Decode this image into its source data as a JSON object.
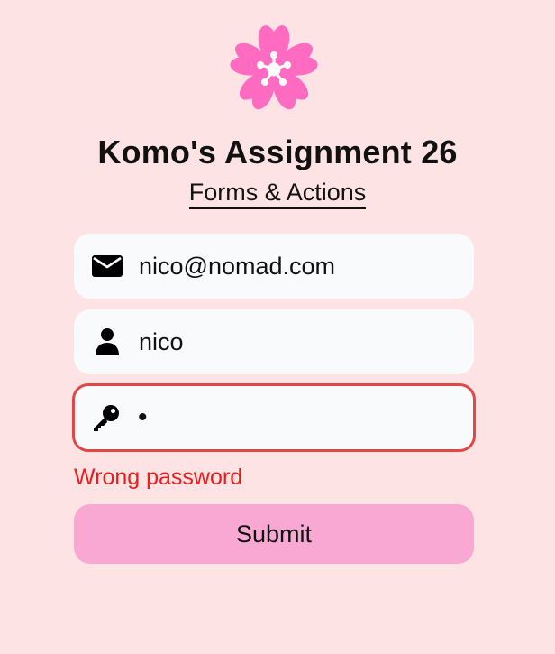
{
  "app": {
    "logo_icon": "cherry-blossom-icon",
    "logo_color": "#ff6bc1",
    "title": "Komo's Assignment 26",
    "subtitle": "Forms & Actions"
  },
  "form": {
    "email": {
      "icon": "envelope-icon",
      "value": "nico@nomad.com"
    },
    "username": {
      "icon": "user-icon",
      "value": "nico"
    },
    "password": {
      "icon": "key-icon",
      "value": "•",
      "state": "error",
      "error_color": "#e04848"
    },
    "error_message": "Wrong password",
    "submit_label": "Submit",
    "submit_color": "#f9a8d4"
  },
  "colors": {
    "background": "#fde3e3",
    "field_background": "#f8fafc",
    "error_text": "#ee1c1c"
  }
}
